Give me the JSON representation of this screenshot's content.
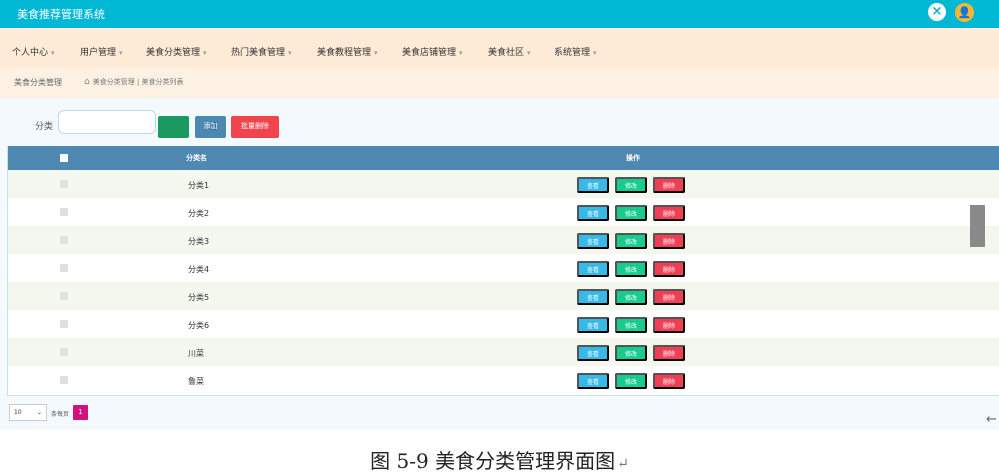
{
  "header": {
    "title": "美食推荐管理系统",
    "close_icon": "×",
    "avatar_icon": "👤"
  },
  "nav": {
    "caret": "▾",
    "items": [
      {
        "label": "个人中心"
      },
      {
        "label": "用户管理"
      },
      {
        "label": "美食分类管理"
      },
      {
        "label": "热门美食管理"
      },
      {
        "label": "美食教程管理"
      },
      {
        "label": "美食店铺管理"
      },
      {
        "label": "美食社区"
      },
      {
        "label": "系统管理"
      }
    ]
  },
  "breadcrumb": {
    "title": "美食分类管理",
    "home_icon": "⌂",
    "path": "美食分类管理 | 美食分类列表"
  },
  "search": {
    "label": "分类",
    "value": "",
    "placeholder": ""
  },
  "toolbar": {
    "search_label": "",
    "add_label": "添加",
    "bulk_delete_label": "批量删除"
  },
  "table": {
    "columns": [
      "分类名",
      "操作"
    ],
    "actions": {
      "view": "查看",
      "edit": "修改",
      "delete": "删除"
    },
    "rows": [
      {
        "name": "分类1"
      },
      {
        "name": "分类2"
      },
      {
        "name": "分类3"
      },
      {
        "name": "分类4"
      },
      {
        "name": "分类5"
      },
      {
        "name": "分类6"
      },
      {
        "name": "川菜"
      },
      {
        "name": "鲁菜"
      }
    ]
  },
  "pagination": {
    "page_size": "10",
    "page_size_chevron": "⌄",
    "page_size_label": "条每页",
    "current_page": "1"
  },
  "side_arrow": "←",
  "caption": {
    "text": "图 5-9 美食分类管理界面图",
    "mark": "↵"
  },
  "colors": {
    "header_bg": "#00b7d4",
    "nav_bg": "#fdebd8",
    "table_header_bg": "#4f88b0",
    "view_button": "#35b9e6",
    "edit_button": "#17cc8e",
    "delete_button": "#f03e55",
    "search_button": "#1a9a5e",
    "add_button": "#4b89b1",
    "bulk_delete_button": "#f0454f",
    "page_active": "#d1127a"
  }
}
